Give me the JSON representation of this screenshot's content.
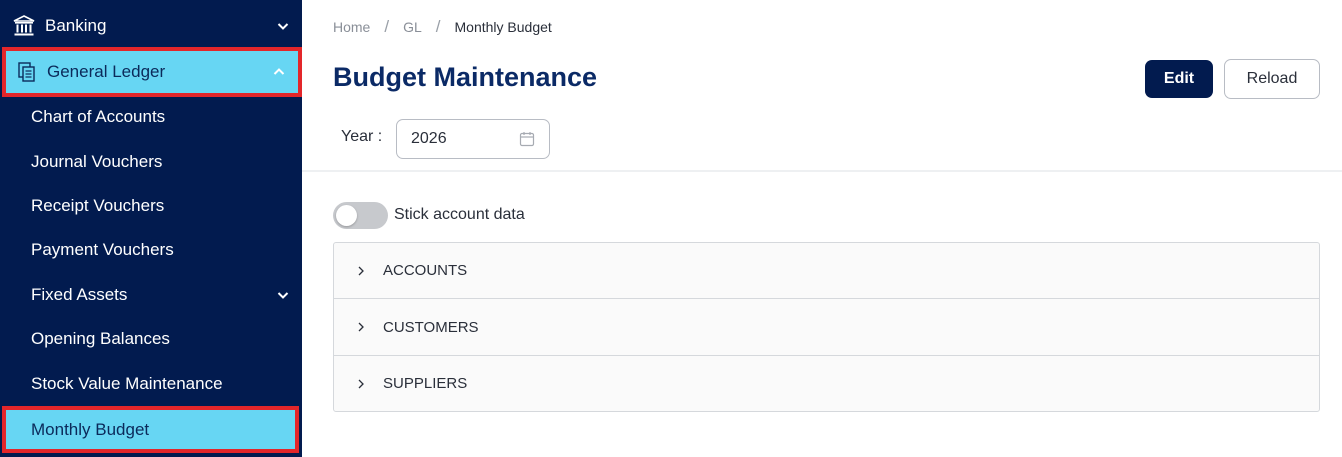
{
  "sidebar": {
    "banking": {
      "label": "Banking",
      "icon": "bank-icon"
    },
    "general_ledger": {
      "label": "General Ledger",
      "icon": "ledger-icon"
    },
    "items": [
      {
        "label": "Chart of Accounts"
      },
      {
        "label": "Journal Vouchers"
      },
      {
        "label": "Receipt Vouchers"
      },
      {
        "label": "Payment Vouchers"
      },
      {
        "label": "Fixed Assets",
        "icon": "chevron-down-icon"
      },
      {
        "label": "Opening Balances"
      },
      {
        "label": "Stock Value Maintenance"
      },
      {
        "label": "Monthly Budget"
      }
    ],
    "colors": {
      "background": "#021b4f",
      "active": "#67d6f3",
      "highlight_border": "#e3262a"
    }
  },
  "breadcrumb": {
    "items": [
      "Home",
      "GL",
      "Monthly Budget"
    ],
    "separator": "/"
  },
  "page": {
    "title": "Budget Maintenance",
    "edit_label": "Edit",
    "reload_label": "Reload",
    "year_label": "Year :",
    "year_value": "2026",
    "toggle_label": "Stick account data",
    "toggle_on": false
  },
  "accordion": {
    "items": [
      "ACCOUNTS",
      "CUSTOMERS",
      "SUPPLIERS"
    ]
  }
}
